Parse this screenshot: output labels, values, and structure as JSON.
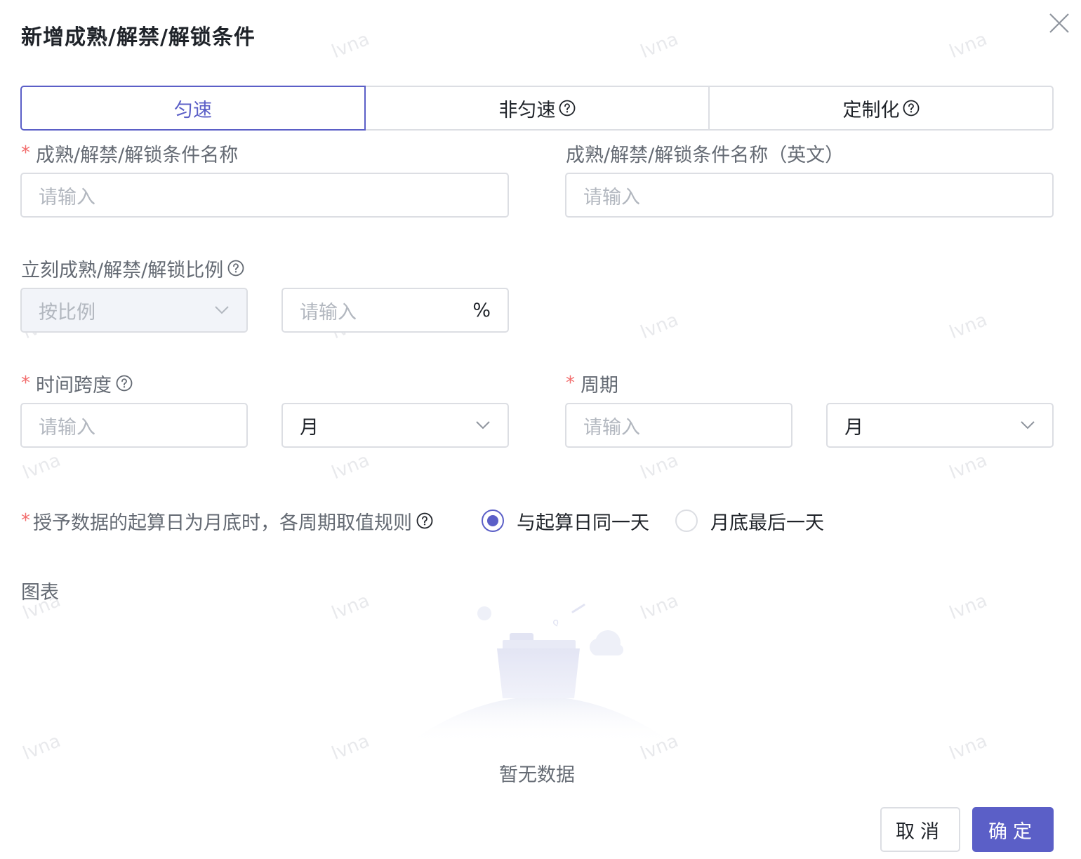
{
  "dialog": {
    "title": "新增成熟/解禁/解锁条件",
    "close_icon": "close-icon"
  },
  "watermark": "lvna",
  "tabs": [
    {
      "label": "匀速",
      "active": true,
      "help": false
    },
    {
      "label": "非匀速",
      "active": false,
      "help": true
    },
    {
      "label": "定制化",
      "active": false,
      "help": true
    }
  ],
  "fields": {
    "name": {
      "label": "成熟/解禁/解锁条件名称",
      "required": true,
      "placeholder": "请输入"
    },
    "name_en": {
      "label": "成熟/解禁/解锁条件名称（英文）",
      "required": false,
      "placeholder": "请输入"
    },
    "ratio": {
      "label": "立刻成熟/解禁/解锁比例",
      "mode_value": "按比例",
      "input_placeholder": "请输入",
      "suffix": "%"
    },
    "time_span": {
      "label": "时间跨度",
      "required": true,
      "placeholder": "请输入",
      "unit": "月"
    },
    "period": {
      "label": "周期",
      "required": true,
      "placeholder": "请输入",
      "unit": "月"
    },
    "rule": {
      "label": "授予数据的起算日为月底时，各周期取值规则",
      "required": true,
      "options": [
        {
          "label": "与起算日同一天",
          "checked": true
        },
        {
          "label": "月底最后一天",
          "checked": false
        }
      ]
    }
  },
  "chart": {
    "label": "图表",
    "empty_text": "暂无数据"
  },
  "footer": {
    "cancel": "取消",
    "confirm": "确定"
  },
  "colors": {
    "accent": "#5b5fc7",
    "required": "#f26d6d",
    "border": "#dcdee3"
  }
}
